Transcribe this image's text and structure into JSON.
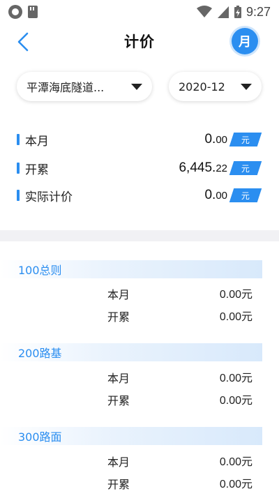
{
  "status_bar": {
    "time": "9:27",
    "icons": [
      "circle-notification-icon",
      "sd-card-icon",
      "wifi-icon",
      "signal-icon",
      "battery-charging-icon"
    ]
  },
  "header": {
    "title": "计价",
    "back_icon": "chevron-left-icon",
    "month_button_label": "月",
    "accent_color": "#2b8ef0"
  },
  "selectors": {
    "project": "平潭海底隧道...",
    "date": "2020-12"
  },
  "summary": [
    {
      "label": "本月",
      "value_int": "0.",
      "value_dec": "00",
      "unit": "元"
    },
    {
      "label": "开累",
      "value_int": "6,445.",
      "value_dec": "22",
      "unit": "元"
    },
    {
      "label": "实际计价",
      "value_int": "0.",
      "value_dec": "00",
      "unit": "元"
    }
  ],
  "sections": [
    {
      "title": "100总则",
      "rows": [
        {
          "label": "本月",
          "value": "0.00元"
        },
        {
          "label": "开累",
          "value": "0.00元"
        }
      ]
    },
    {
      "title": "200路基",
      "rows": [
        {
          "label": "本月",
          "value": "0.00元"
        },
        {
          "label": "开累",
          "value": "0.00元"
        }
      ]
    },
    {
      "title": "300路面",
      "rows": [
        {
          "label": "本月",
          "value": "0.00元"
        },
        {
          "label": "开累",
          "value": "0.00元"
        }
      ]
    }
  ]
}
